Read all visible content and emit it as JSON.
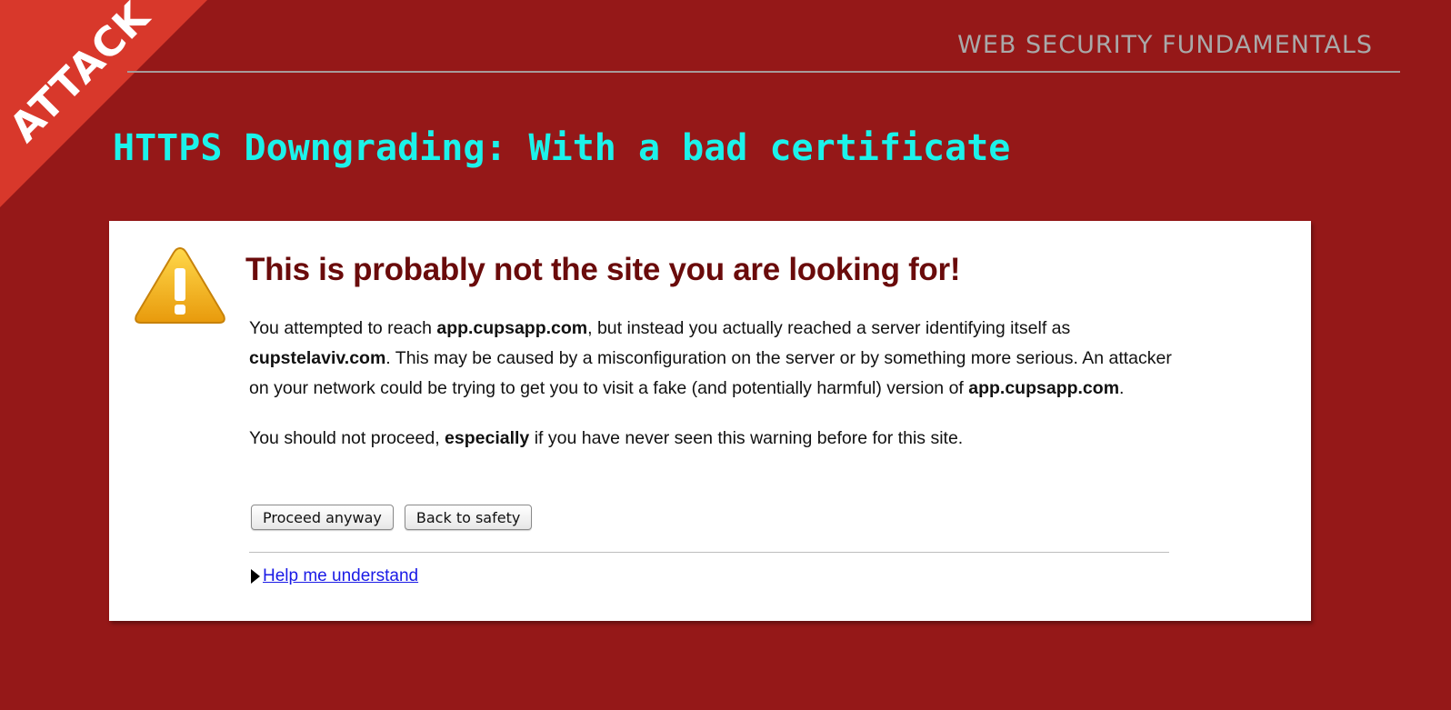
{
  "corner_label": "ATTACK",
  "deck_title": "WEB SECURITY FUNDAMENTALS",
  "slide_title": "HTTPS Downgrading: With a bad certificate",
  "warning": {
    "heading": "This is probably not the site you are looking for!",
    "p1_intro": "You attempted to reach ",
    "p1_domain_requested": "app.cupsapp.com",
    "p1_mid": ", but instead you actually reached a server identifying itself as ",
    "p1_domain_actual": "cupstelaviv.com",
    "p1_rest": ". This may be caused by a misconfiguration on the server or by something more serious. An attacker on your network could be trying to get you to visit a fake (and potentially harmful) version of ",
    "p1_domain_requested_again": "app.cupsapp.com",
    "p1_end": ".",
    "p2_intro": "You should not proceed, ",
    "p2_emphasis": "especially",
    "p2_rest": " if you have never seen this warning before for this site.",
    "proceed_button": "Proceed anyway",
    "back_button": "Back to safety",
    "help_link": "Help me understand",
    "icon": "warning-triangle-icon"
  },
  "colors": {
    "background": "#951818",
    "corner": "#d8382b",
    "slide_title": "#1cf2ea",
    "heading": "#6a0b0b",
    "link": "#1a1ae6",
    "icon_fill": "#f2b418"
  }
}
